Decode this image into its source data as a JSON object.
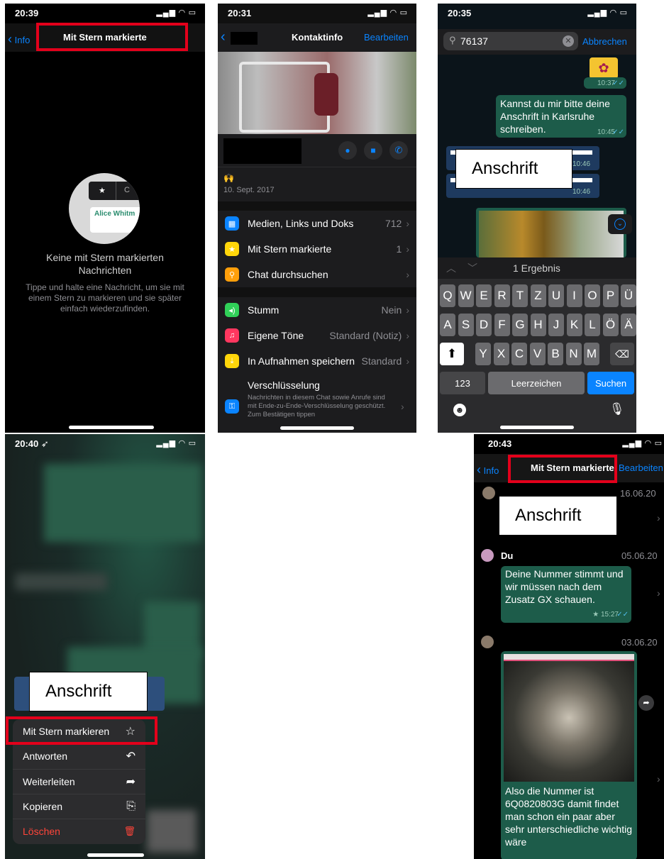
{
  "panel1": {
    "time": "20:39",
    "back_label": "Info",
    "title": "Mit Stern markierte",
    "illus_name": "Alice Whitm",
    "illus_tab": "C",
    "empty_title": "Keine mit Stern markierten Nachrichten",
    "empty_body": "Tippe und halte eine Nachricht, um sie mit einem Stern zu markieren und sie später einfach wiederzufinden."
  },
  "panel2": {
    "time": "20:31",
    "title": "Kontaktinfo",
    "edit_label": "Bearbeiten",
    "date": "10. Sept. 2017",
    "rows": [
      {
        "label": "Medien, Links und Doks",
        "value": "712",
        "color": "#0a84ff",
        "icon": "image-icon"
      },
      {
        "label": "Mit Stern markierte",
        "value": "1",
        "color": "#ffd60a",
        "icon": "star-icon"
      },
      {
        "label": "Chat durchsuchen",
        "value": "",
        "color": "#ff9f0a",
        "icon": "search-icon"
      },
      {
        "label": "Stumm",
        "value": "Nein",
        "color": "#30d158",
        "icon": "speaker-icon"
      },
      {
        "label": "Eigene Töne",
        "value": "Standard (Notiz)",
        "color": "#ff375f",
        "icon": "music-icon"
      },
      {
        "label": "In Aufnahmen speichern",
        "value": "Standard",
        "color": "#ffd60a",
        "icon": "download-icon"
      }
    ],
    "encryption_title": "Verschlüsselung",
    "encryption_body": "Nachrichten in diesem Chat sowie Anrufe sind mit Ende-zu-Ende-Verschlüsselung geschützt. Zum Bestätigen tippen"
  },
  "panel3": {
    "time": "20:35",
    "search_value": "76137",
    "cancel_label": "Abbrechen",
    "time_top": "10:37",
    "message": "Kannst du mir bitte deine Anschrift in Karlsruhe schreiben.",
    "message_time": "10:45",
    "time_a": "10:46",
    "time_b": "10:46",
    "annotation": "Anschrift",
    "result_label": "1 Ergebnis",
    "row1": [
      "Q",
      "W",
      "E",
      "R",
      "T",
      "Z",
      "U",
      "I",
      "O",
      "P",
      "Ü"
    ],
    "row2": [
      "A",
      "S",
      "D",
      "F",
      "G",
      "H",
      "J",
      "K",
      "L",
      "Ö",
      "Ä"
    ],
    "row3": [
      "Y",
      "X",
      "C",
      "V",
      "B",
      "N",
      "M"
    ],
    "key_123": "123",
    "key_space": "Leerzeichen",
    "key_search": "Suchen"
  },
  "panel4": {
    "time": "20:40",
    "annotation": "Anschrift",
    "menu": [
      {
        "label": "Mit Stern markieren",
        "icon": "☆",
        "icon_name": "star-outline-icon",
        "danger": false
      },
      {
        "label": "Antworten",
        "icon": "↶",
        "icon_name": "reply-icon",
        "danger": false
      },
      {
        "label": "Weiterleiten",
        "icon": "➦",
        "icon_name": "forward-icon",
        "danger": false
      },
      {
        "label": "Kopieren",
        "icon": "⎘",
        "icon_name": "copy-icon",
        "danger": false
      },
      {
        "label": "Löschen",
        "icon": "🗑",
        "icon_name": "trash-icon",
        "danger": true
      }
    ]
  },
  "panel5": {
    "time": "20:43",
    "back_label": "Info",
    "title": "Mit Stern markierte",
    "edit_label": "Bearbeiten",
    "date1": "16.06.20",
    "annotation": "Anschrift",
    "sender": "Du",
    "date2": "05.06.20",
    "message": "Deine Nummer stimmt und wir müssen nach dem Zusatz GX schauen.",
    "message_time": "★ 15:27",
    "date3": "03.06.20",
    "caption": "Also die Nummer ist 6Q0820803G damit findet man schon ein paar aber sehr unterschiedliche wichtig wäre"
  }
}
